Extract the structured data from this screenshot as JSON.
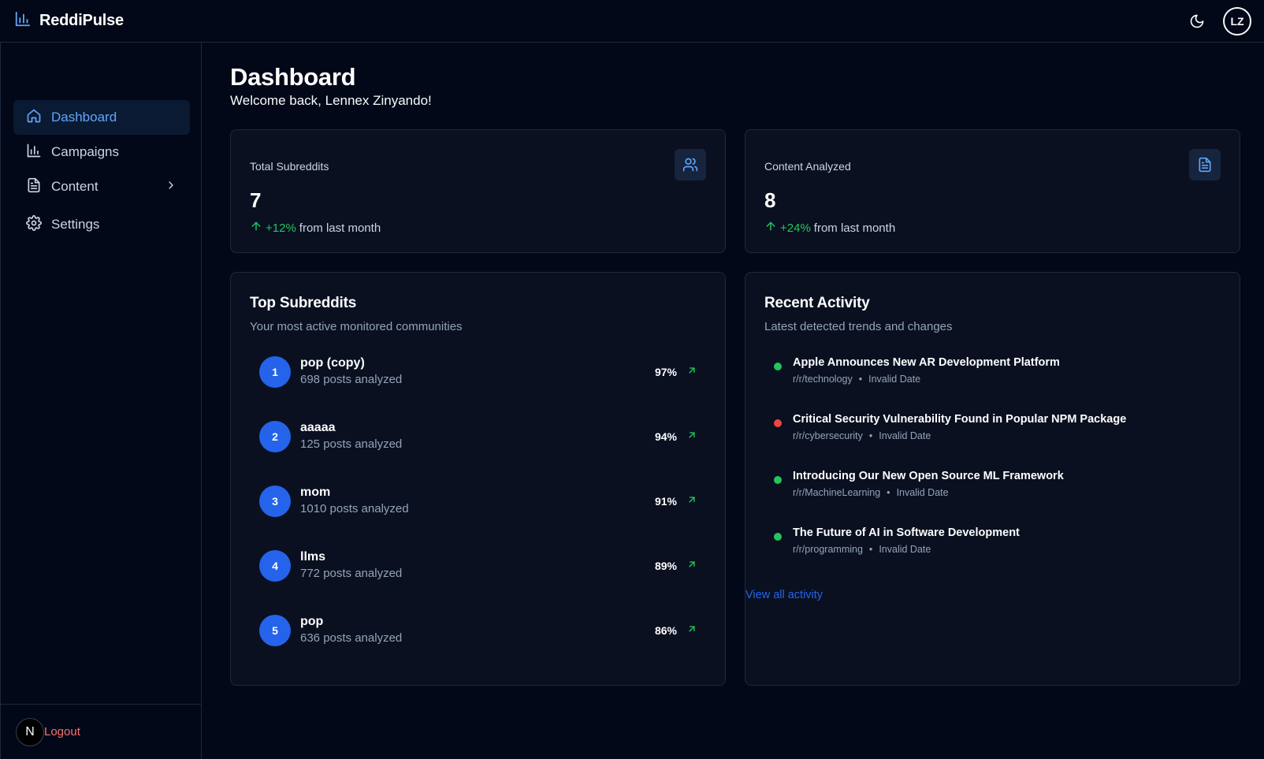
{
  "app": {
    "name": "ReddiPulse"
  },
  "user": {
    "initials": "LZ"
  },
  "sidebar": {
    "items": [
      {
        "label": "Dashboard",
        "icon": "home-icon",
        "active": true
      },
      {
        "label": "Campaigns",
        "icon": "bar-chart-icon"
      },
      {
        "label": "Content",
        "icon": "file-text-icon",
        "expandable": true
      },
      {
        "label": "Settings",
        "icon": "gear-icon"
      }
    ],
    "logout_label": "Logout",
    "logo_letter": "N"
  },
  "page": {
    "title": "Dashboard",
    "welcome": "Welcome back, Lennex Zinyando!"
  },
  "stats": [
    {
      "label": "Total Subreddits",
      "value": "7",
      "change": "+12%",
      "change_suffix": "from last month",
      "icon": "users-icon"
    },
    {
      "label": "Content Analyzed",
      "value": "8",
      "change": "+24%",
      "change_suffix": "from last month",
      "icon": "file-text-icon"
    }
  ],
  "top_subreddits": {
    "title": "Top Subreddits",
    "subtitle": "Your most active monitored communities",
    "items": [
      {
        "rank": "1",
        "name": "pop (copy)",
        "posts": "698 posts analyzed",
        "pct": "97%"
      },
      {
        "rank": "2",
        "name": "aaaaa",
        "posts": "125 posts analyzed",
        "pct": "94%"
      },
      {
        "rank": "3",
        "name": "mom",
        "posts": "1010 posts analyzed",
        "pct": "91%"
      },
      {
        "rank": "4",
        "name": "llms",
        "posts": "772 posts analyzed",
        "pct": "89%"
      },
      {
        "rank": "5",
        "name": "pop",
        "posts": "636 posts analyzed",
        "pct": "86%"
      }
    ]
  },
  "recent_activity": {
    "title": "Recent Activity",
    "subtitle": "Latest detected trends and changes",
    "items": [
      {
        "title": "Apple Announces New AR Development Platform",
        "subreddit": "r/r/technology",
        "date": "Invalid Date",
        "status_color": "#22c55e"
      },
      {
        "title": "Critical Security Vulnerability Found in Popular NPM Package",
        "subreddit": "r/r/cybersecurity",
        "date": "Invalid Date",
        "status_color": "#ef4444"
      },
      {
        "title": "Introducing Our New Open Source ML Framework",
        "subreddit": "r/r/MachineLearning",
        "date": "Invalid Date",
        "status_color": "#22c55e"
      },
      {
        "title": "The Future of AI in Software Development",
        "subreddit": "r/r/programming",
        "date": "Invalid Date",
        "status_color": "#22c55e"
      }
    ],
    "view_all": "View all activity"
  },
  "colors": {
    "accent": "#60a5fa",
    "primary": "#2563eb",
    "positive": "#22c55e",
    "negative": "#ef4444",
    "logout": "#f87171",
    "background": "#020817"
  }
}
